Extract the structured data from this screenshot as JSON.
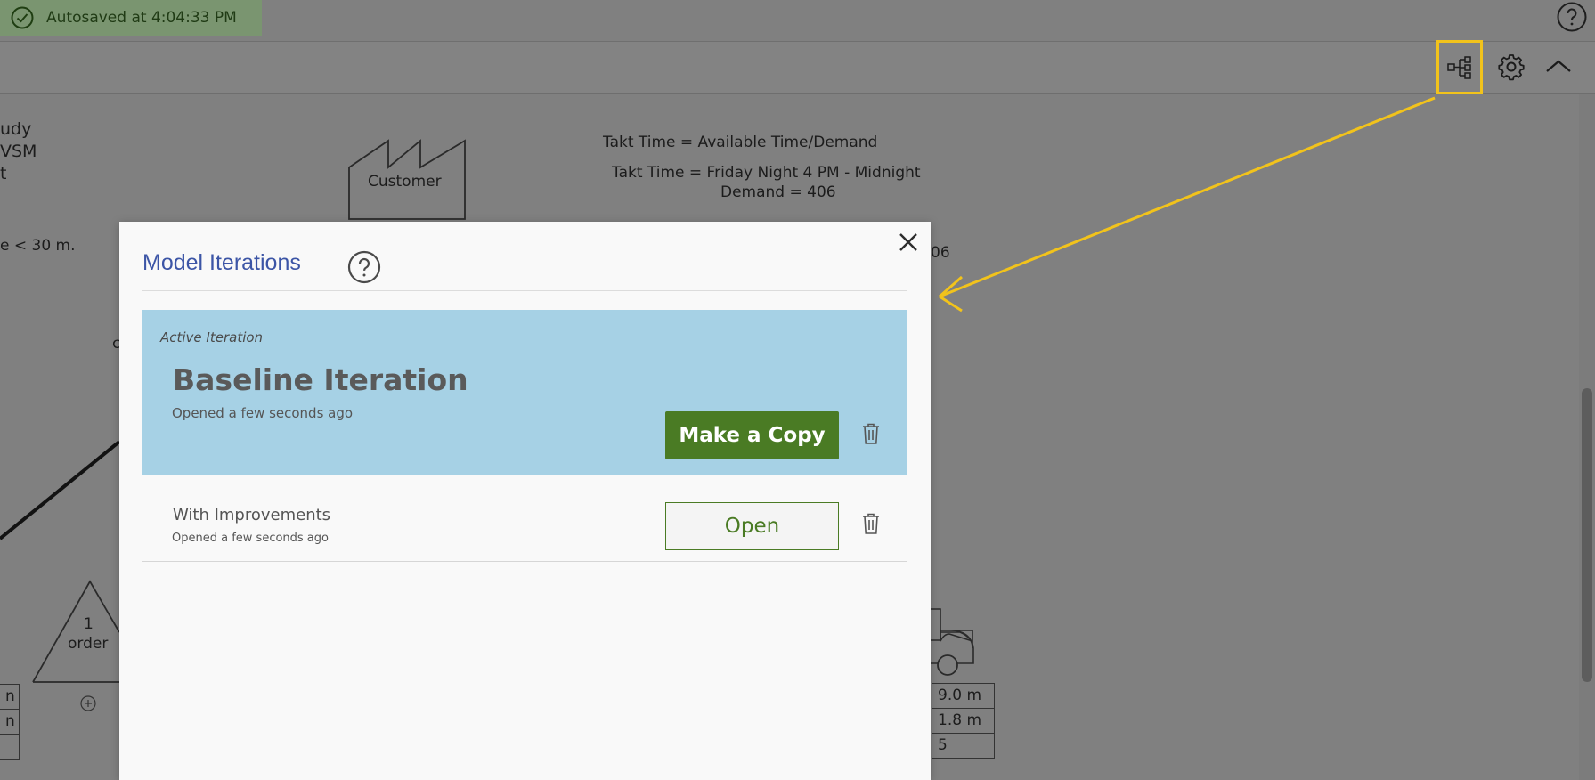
{
  "topbar": {
    "autosave_text": "Autosaved at 4:04:33 PM",
    "check_icon": "check-circle-icon",
    "help_icon": "help-circle-icon"
  },
  "toolbar": {
    "iterations_icon": "iteration-tree-icon",
    "settings_icon": "gear-icon",
    "collapse_icon": "chevron-up-icon",
    "highlight_color": "#f2c31b"
  },
  "canvas": {
    "left_text_1": "udy",
    "left_text_2": "VSM",
    "left_text_3": "t",
    "left_text_4": "e < 30 m.",
    "left_text_5": "c",
    "customer_label": "Customer",
    "takt_line_1": "Takt Time = Available Time/Demand",
    "takt_line_2": "Takt Time = Friday Night 4 PM - Midnight",
    "takt_line_3": "Demand = 406",
    "partial_number": "06",
    "inventory_qty": "1",
    "inventory_unit": "order",
    "left_cell_1": "n",
    "left_cell_2": "n",
    "right_cell_1": "9.0 m",
    "right_cell_2": "1.8 m",
    "right_cell_3": "5"
  },
  "modal": {
    "title": "Model Iterations",
    "close_icon": "close-icon",
    "help_icon": "help-circle-icon",
    "active_caption": "Active Iteration",
    "active_name": "Baseline Iteration",
    "active_opened": "Opened a few seconds ago",
    "copy_label": "Make a Copy",
    "iterations": [
      {
        "name": "With Improvements",
        "opened": "Opened a few seconds ago",
        "open_label": "Open"
      }
    ],
    "colors": {
      "active_bg": "#a6d1e5",
      "button_green": "#4a7b24",
      "title_blue": "#3c55a6"
    }
  }
}
